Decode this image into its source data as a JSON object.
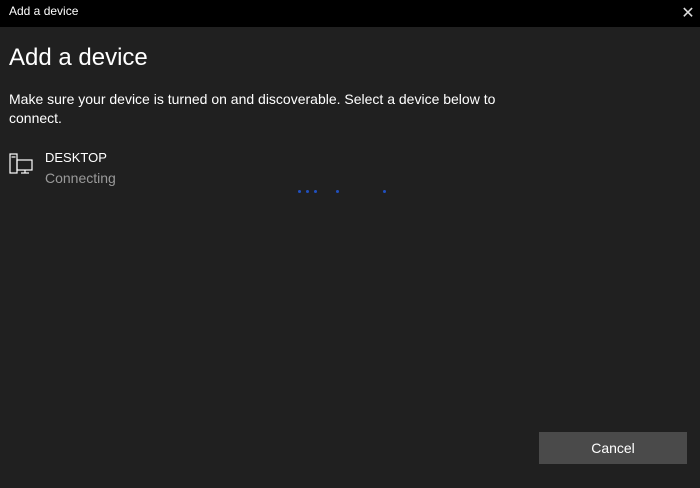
{
  "window": {
    "title": "Add a device",
    "close_icon": "close-icon"
  },
  "heading": "Add a device",
  "description": "Make sure your device is turned on and discoverable. Select a device below to connect.",
  "device": {
    "name": "DESKTOP",
    "status": "Connecting",
    "icon": "desktop-icon"
  },
  "progress": {
    "icon": "progress-dots",
    "color": "#2050c0"
  },
  "buttons": {
    "cancel": "Cancel"
  }
}
